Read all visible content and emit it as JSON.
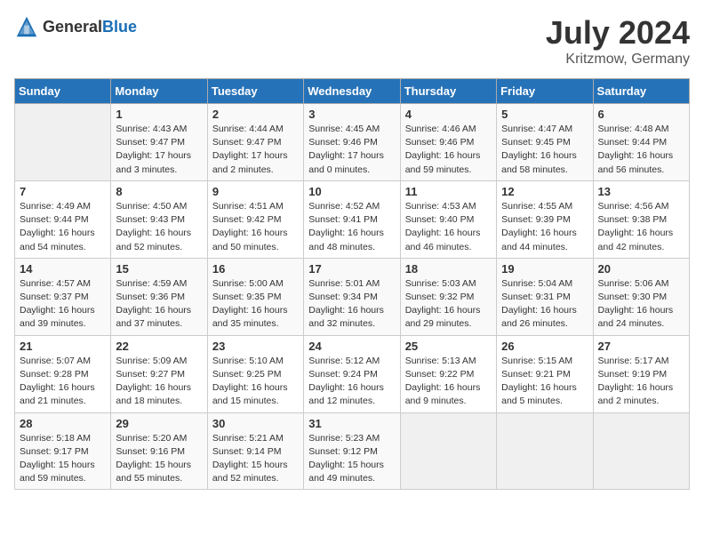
{
  "logo": {
    "general": "General",
    "blue": "Blue"
  },
  "header": {
    "month_year": "July 2024",
    "location": "Kritzmow, Germany"
  },
  "days_of_week": [
    "Sunday",
    "Monday",
    "Tuesday",
    "Wednesday",
    "Thursday",
    "Friday",
    "Saturday"
  ],
  "weeks": [
    [
      {
        "day": "",
        "info": ""
      },
      {
        "day": "1",
        "info": "Sunrise: 4:43 AM\nSunset: 9:47 PM\nDaylight: 17 hours\nand 3 minutes."
      },
      {
        "day": "2",
        "info": "Sunrise: 4:44 AM\nSunset: 9:47 PM\nDaylight: 17 hours\nand 2 minutes."
      },
      {
        "day": "3",
        "info": "Sunrise: 4:45 AM\nSunset: 9:46 PM\nDaylight: 17 hours\nand 0 minutes."
      },
      {
        "day": "4",
        "info": "Sunrise: 4:46 AM\nSunset: 9:46 PM\nDaylight: 16 hours\nand 59 minutes."
      },
      {
        "day": "5",
        "info": "Sunrise: 4:47 AM\nSunset: 9:45 PM\nDaylight: 16 hours\nand 58 minutes."
      },
      {
        "day": "6",
        "info": "Sunrise: 4:48 AM\nSunset: 9:44 PM\nDaylight: 16 hours\nand 56 minutes."
      }
    ],
    [
      {
        "day": "7",
        "info": "Sunrise: 4:49 AM\nSunset: 9:44 PM\nDaylight: 16 hours\nand 54 minutes."
      },
      {
        "day": "8",
        "info": "Sunrise: 4:50 AM\nSunset: 9:43 PM\nDaylight: 16 hours\nand 52 minutes."
      },
      {
        "day": "9",
        "info": "Sunrise: 4:51 AM\nSunset: 9:42 PM\nDaylight: 16 hours\nand 50 minutes."
      },
      {
        "day": "10",
        "info": "Sunrise: 4:52 AM\nSunset: 9:41 PM\nDaylight: 16 hours\nand 48 minutes."
      },
      {
        "day": "11",
        "info": "Sunrise: 4:53 AM\nSunset: 9:40 PM\nDaylight: 16 hours\nand 46 minutes."
      },
      {
        "day": "12",
        "info": "Sunrise: 4:55 AM\nSunset: 9:39 PM\nDaylight: 16 hours\nand 44 minutes."
      },
      {
        "day": "13",
        "info": "Sunrise: 4:56 AM\nSunset: 9:38 PM\nDaylight: 16 hours\nand 42 minutes."
      }
    ],
    [
      {
        "day": "14",
        "info": "Sunrise: 4:57 AM\nSunset: 9:37 PM\nDaylight: 16 hours\nand 39 minutes."
      },
      {
        "day": "15",
        "info": "Sunrise: 4:59 AM\nSunset: 9:36 PM\nDaylight: 16 hours\nand 37 minutes."
      },
      {
        "day": "16",
        "info": "Sunrise: 5:00 AM\nSunset: 9:35 PM\nDaylight: 16 hours\nand 35 minutes."
      },
      {
        "day": "17",
        "info": "Sunrise: 5:01 AM\nSunset: 9:34 PM\nDaylight: 16 hours\nand 32 minutes."
      },
      {
        "day": "18",
        "info": "Sunrise: 5:03 AM\nSunset: 9:32 PM\nDaylight: 16 hours\nand 29 minutes."
      },
      {
        "day": "19",
        "info": "Sunrise: 5:04 AM\nSunset: 9:31 PM\nDaylight: 16 hours\nand 26 minutes."
      },
      {
        "day": "20",
        "info": "Sunrise: 5:06 AM\nSunset: 9:30 PM\nDaylight: 16 hours\nand 24 minutes."
      }
    ],
    [
      {
        "day": "21",
        "info": "Sunrise: 5:07 AM\nSunset: 9:28 PM\nDaylight: 16 hours\nand 21 minutes."
      },
      {
        "day": "22",
        "info": "Sunrise: 5:09 AM\nSunset: 9:27 PM\nDaylight: 16 hours\nand 18 minutes."
      },
      {
        "day": "23",
        "info": "Sunrise: 5:10 AM\nSunset: 9:25 PM\nDaylight: 16 hours\nand 15 minutes."
      },
      {
        "day": "24",
        "info": "Sunrise: 5:12 AM\nSunset: 9:24 PM\nDaylight: 16 hours\nand 12 minutes."
      },
      {
        "day": "25",
        "info": "Sunrise: 5:13 AM\nSunset: 9:22 PM\nDaylight: 16 hours\nand 9 minutes."
      },
      {
        "day": "26",
        "info": "Sunrise: 5:15 AM\nSunset: 9:21 PM\nDaylight: 16 hours\nand 5 minutes."
      },
      {
        "day": "27",
        "info": "Sunrise: 5:17 AM\nSunset: 9:19 PM\nDaylight: 16 hours\nand 2 minutes."
      }
    ],
    [
      {
        "day": "28",
        "info": "Sunrise: 5:18 AM\nSunset: 9:17 PM\nDaylight: 15 hours\nand 59 minutes."
      },
      {
        "day": "29",
        "info": "Sunrise: 5:20 AM\nSunset: 9:16 PM\nDaylight: 15 hours\nand 55 minutes."
      },
      {
        "day": "30",
        "info": "Sunrise: 5:21 AM\nSunset: 9:14 PM\nDaylight: 15 hours\nand 52 minutes."
      },
      {
        "day": "31",
        "info": "Sunrise: 5:23 AM\nSunset: 9:12 PM\nDaylight: 15 hours\nand 49 minutes."
      },
      {
        "day": "",
        "info": ""
      },
      {
        "day": "",
        "info": ""
      },
      {
        "day": "",
        "info": ""
      }
    ]
  ]
}
